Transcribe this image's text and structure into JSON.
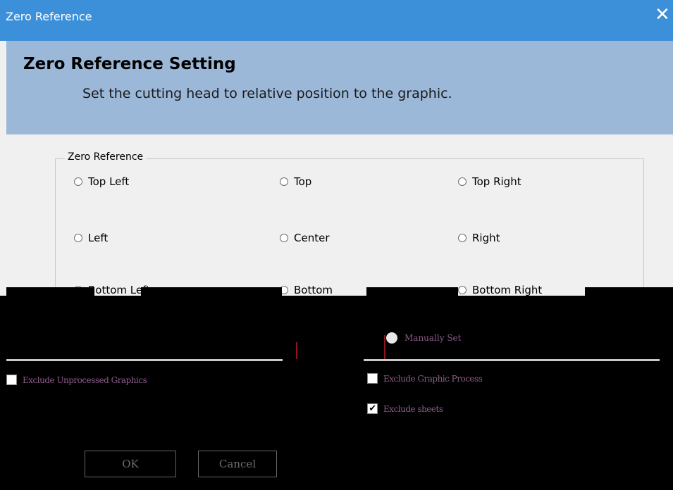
{
  "window": {
    "title": "Zero Reference",
    "close_glyph": "✕"
  },
  "banner": {
    "heading": "Zero Reference Setting",
    "subtitle": "Set the cutting head to relative position to the graphic."
  },
  "zero_reference": {
    "legend": "Zero Reference",
    "options": [
      "Top Left",
      "Top",
      "Top Right",
      "Left",
      "Center",
      "Right",
      "Bottom Left",
      "Bottom",
      "Bottom Right"
    ]
  },
  "manually_set": {
    "label": "Manually Set"
  },
  "checkboxes": {
    "exclude_unprocessed": {
      "label": "Exclude Unprocessed Graphics",
      "checked": false
    },
    "exclude_graphic_process": {
      "label": "Exclude Graphic Process",
      "checked": false
    },
    "exclude_sheets": {
      "label": "Exclude sheets",
      "checked": true
    }
  },
  "buttons": {
    "ok": "OK",
    "cancel": "Cancel"
  },
  "colors": {
    "titlebar": "#3c8fd9",
    "banner": "#9cb8d9",
    "content_bg": "#f0f0f0"
  }
}
